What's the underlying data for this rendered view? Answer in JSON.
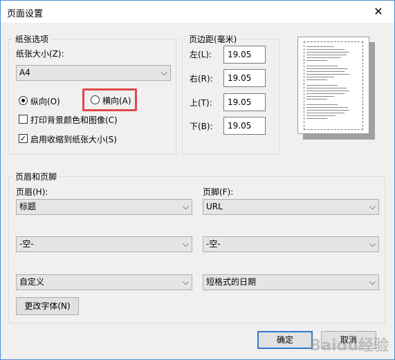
{
  "window": {
    "title": "页面设置",
    "close_glyph": "✕"
  },
  "paper": {
    "group_label": "纸张选项",
    "size_label": "纸张大小(Z):",
    "size_value": "A4",
    "portrait_label": "纵向(O)",
    "landscape_label": "横向(A)",
    "orientation_selected": "portrait",
    "print_bg_label": "打印背景颜色和图像(C)",
    "print_bg_checked": false,
    "shrink_label": "启用收缩到纸张大小(S)",
    "shrink_checked": true
  },
  "margins": {
    "group_label": "页边距(毫米)",
    "left_label": "左(L):",
    "left_value": "19.05",
    "right_label": "右(R):",
    "right_value": "19.05",
    "top_label": "上(T):",
    "top_value": "19.05",
    "bottom_label": "下(B):",
    "bottom_value": "19.05"
  },
  "header_footer": {
    "group_label": "页眉和页脚",
    "header_label": "页眉(H):",
    "footer_label": "页脚(F):",
    "header_1": "标题",
    "header_2": "-空-",
    "header_3": "自定义",
    "footer_1": "URL",
    "footer_2": "-空-",
    "footer_3": "短格式的日期",
    "font_button": "更改字体(N)"
  },
  "buttons": {
    "ok": "确定",
    "cancel": "取消"
  },
  "watermark": "Baidu经验",
  "colors": {
    "highlight": "#e04848",
    "default_button_border": "#2b79d0"
  }
}
